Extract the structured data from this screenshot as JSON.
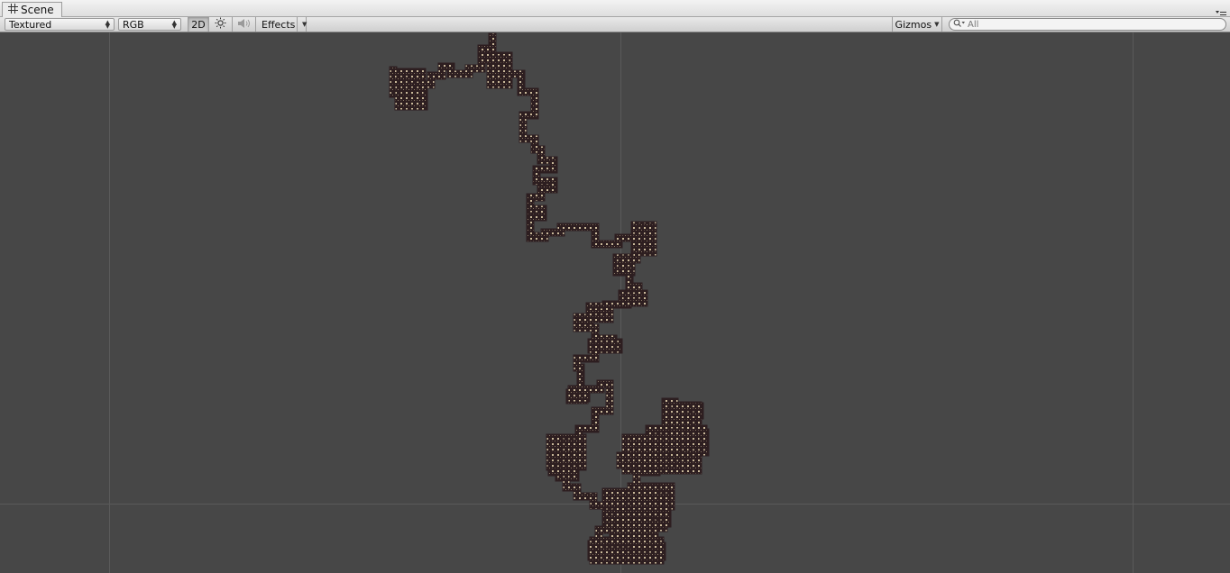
{
  "window": {
    "tab_label": "Scene",
    "tab_icon": "grid-icon",
    "menu_icon": "tab-menu-icon"
  },
  "toolbar": {
    "draw_mode": "Textured",
    "render_mode": "RGB",
    "mode_2d_label": "2D",
    "mode_2d_active": true,
    "lighting_icon": "sun-icon",
    "audio_icon": "speaker-icon",
    "effects_label": "Effects",
    "gizmos_label": "Gizmos",
    "search_placeholder": "All",
    "search_value": ""
  },
  "viewport": {
    "background_color": "#474747",
    "grid_line_color": "#5a5a5a",
    "tile_fill_color": "#2d1e20",
    "tile_pattern_color": "#c9b99a"
  }
}
